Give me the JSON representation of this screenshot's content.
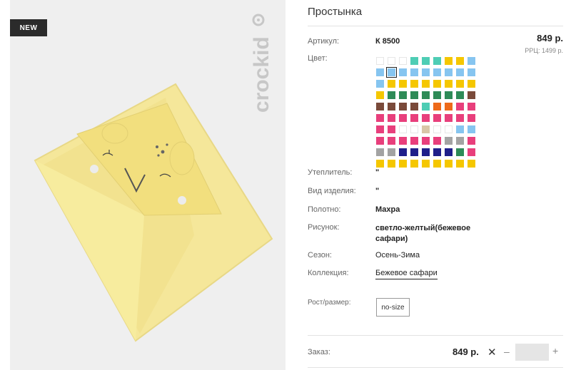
{
  "badge": "NEW",
  "brand": "crockid",
  "product": {
    "title": "Простынка",
    "article_label": "Артикул:",
    "article": "К 8500",
    "price": "849 р.",
    "rrp": "РРЦ: 1499 р.",
    "color_label": "Цвет:",
    "insulation_label": "Утеплитель:",
    "insulation": "\"",
    "kind_label": "Вид изделия:",
    "kind": "\"",
    "fabric_label": "Полотно:",
    "fabric": "Махра",
    "pattern_label": "Рисунок:",
    "pattern": "светло-желтый(бежевое сафари)",
    "season_label": "Сезон:",
    "season": "Осень-Зима",
    "collection_label": "Коллекция:",
    "collection": "Бежевое сафари",
    "size_label": "Рост/размер:",
    "size": "no-size"
  },
  "order": {
    "label": "Заказ:",
    "price": "849 р.",
    "remove": "✕",
    "minus": "–",
    "plus": "+",
    "quantity": ""
  },
  "swatch_selected_index": 10,
  "swatches": [
    "#ffffff",
    "#ffffff",
    "#ffffff",
    "#4ecdb5",
    "#4ecdb5",
    "#4ecdb5",
    "#f5c700",
    "#f5c700",
    "#86c5f0",
    "#86c5f0",
    "#86c5f0",
    "#86c5f0",
    "#86c5f0",
    "#86c5f0",
    "#86c5f0",
    "#86c5f0",
    "#86c5f0",
    "#86c5f0",
    "#86c5f0",
    "#f5c700",
    "#f5c700",
    "#f5c700",
    "#f5c700",
    "#f5c700",
    "#f5c700",
    "#f5c700",
    "#f5c700",
    "#f5c700",
    "#2e8b57",
    "#2e8b57",
    "#2e8b57",
    "#2e8b57",
    "#2e8b57",
    "#2e8b57",
    "#2e8b57",
    "#7a4a3a",
    "#7a4a3a",
    "#7a4a3a",
    "#7a4a3a",
    "#7a4a3a",
    "#4ecdb5",
    "#ee6a1a",
    "#ee6a1a",
    "#e83f7c",
    "#e83f7c",
    "#e83f7c",
    "#e83f7c",
    "#e83f7c",
    "#e83f7c",
    "#e83f7c",
    "#e83f7c",
    "#e83f7c",
    "#e83f7c",
    "#e83f7c",
    "#e83f7c",
    "#e83f7c",
    "#ffffff",
    "#ffffff",
    "#d9c6a7",
    "#ffffff",
    "#ffffff",
    "#86c5f0",
    "#86c5f0",
    "#e83f7c",
    "#e83f7c",
    "#e83f7c",
    "#e83f7c",
    "#e83f7c",
    "#e83f7c",
    "#a3a3a3",
    "#a3a3a3",
    "#e83f7c",
    "#a3a3a3",
    "#a3a3a3",
    "#1f1f8a",
    "#1f1f8a",
    "#1f1f8a",
    "#1f1f8a",
    "#1f1f8a",
    "#2e8b57",
    "#e83f7c",
    "#f5c700",
    "#f5c700",
    "#f5c700",
    "#f5c700",
    "#f5c700",
    "#f5c700",
    "#f5c700",
    "#f5c700",
    "#f5c700"
  ]
}
